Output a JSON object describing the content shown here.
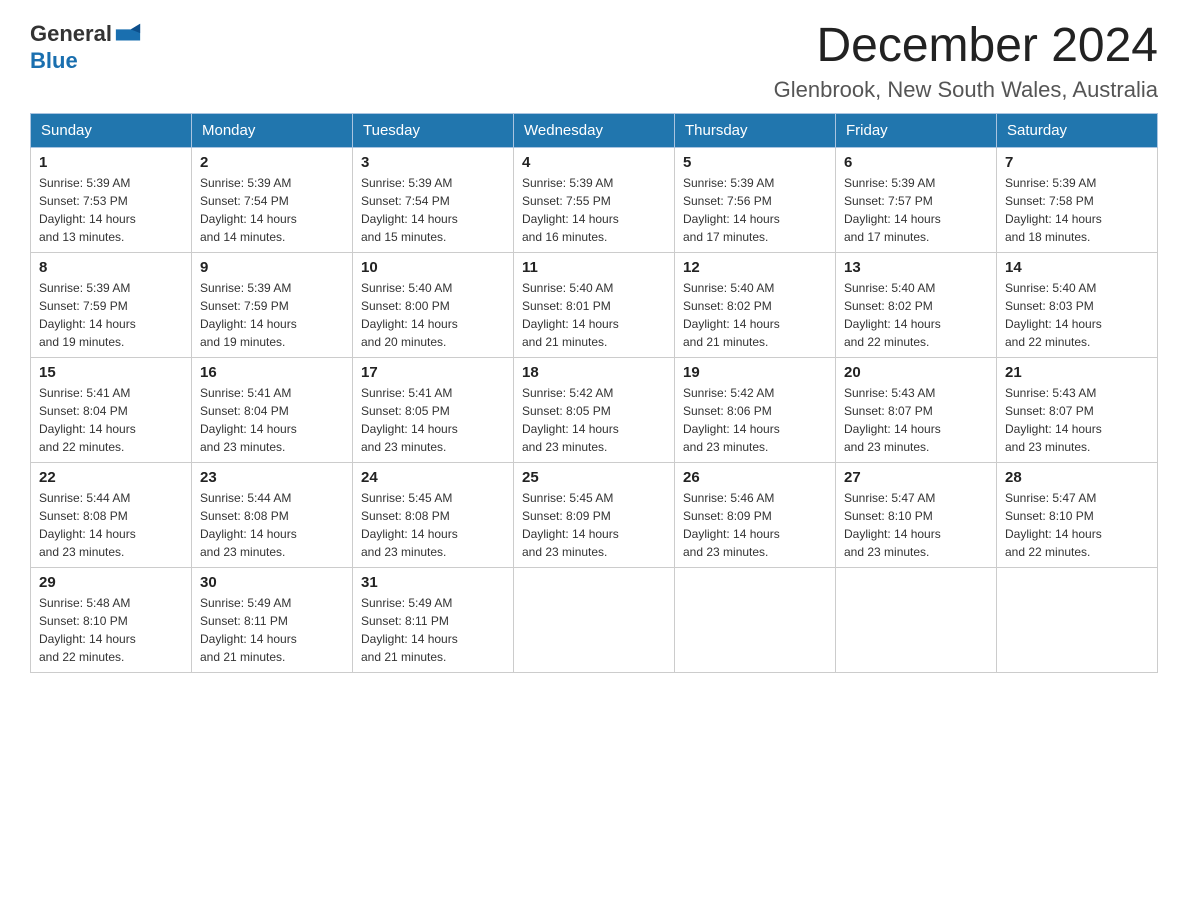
{
  "header": {
    "logo_general": "General",
    "logo_blue": "Blue",
    "month_title": "December 2024",
    "location": "Glenbrook, New South Wales, Australia"
  },
  "days_of_week": [
    "Sunday",
    "Monday",
    "Tuesday",
    "Wednesday",
    "Thursday",
    "Friday",
    "Saturday"
  ],
  "weeks": [
    [
      {
        "day": "1",
        "sunrise": "5:39 AM",
        "sunset": "7:53 PM",
        "daylight": "14 hours and 13 minutes."
      },
      {
        "day": "2",
        "sunrise": "5:39 AM",
        "sunset": "7:54 PM",
        "daylight": "14 hours and 14 minutes."
      },
      {
        "day": "3",
        "sunrise": "5:39 AM",
        "sunset": "7:54 PM",
        "daylight": "14 hours and 15 minutes."
      },
      {
        "day": "4",
        "sunrise": "5:39 AM",
        "sunset": "7:55 PM",
        "daylight": "14 hours and 16 minutes."
      },
      {
        "day": "5",
        "sunrise": "5:39 AM",
        "sunset": "7:56 PM",
        "daylight": "14 hours and 17 minutes."
      },
      {
        "day": "6",
        "sunrise": "5:39 AM",
        "sunset": "7:57 PM",
        "daylight": "14 hours and 17 minutes."
      },
      {
        "day": "7",
        "sunrise": "5:39 AM",
        "sunset": "7:58 PM",
        "daylight": "14 hours and 18 minutes."
      }
    ],
    [
      {
        "day": "8",
        "sunrise": "5:39 AM",
        "sunset": "7:59 PM",
        "daylight": "14 hours and 19 minutes."
      },
      {
        "day": "9",
        "sunrise": "5:39 AM",
        "sunset": "7:59 PM",
        "daylight": "14 hours and 19 minutes."
      },
      {
        "day": "10",
        "sunrise": "5:40 AM",
        "sunset": "8:00 PM",
        "daylight": "14 hours and 20 minutes."
      },
      {
        "day": "11",
        "sunrise": "5:40 AM",
        "sunset": "8:01 PM",
        "daylight": "14 hours and 21 minutes."
      },
      {
        "day": "12",
        "sunrise": "5:40 AM",
        "sunset": "8:02 PM",
        "daylight": "14 hours and 21 minutes."
      },
      {
        "day": "13",
        "sunrise": "5:40 AM",
        "sunset": "8:02 PM",
        "daylight": "14 hours and 22 minutes."
      },
      {
        "day": "14",
        "sunrise": "5:40 AM",
        "sunset": "8:03 PM",
        "daylight": "14 hours and 22 minutes."
      }
    ],
    [
      {
        "day": "15",
        "sunrise": "5:41 AM",
        "sunset": "8:04 PM",
        "daylight": "14 hours and 22 minutes."
      },
      {
        "day": "16",
        "sunrise": "5:41 AM",
        "sunset": "8:04 PM",
        "daylight": "14 hours and 23 minutes."
      },
      {
        "day": "17",
        "sunrise": "5:41 AM",
        "sunset": "8:05 PM",
        "daylight": "14 hours and 23 minutes."
      },
      {
        "day": "18",
        "sunrise": "5:42 AM",
        "sunset": "8:05 PM",
        "daylight": "14 hours and 23 minutes."
      },
      {
        "day": "19",
        "sunrise": "5:42 AM",
        "sunset": "8:06 PM",
        "daylight": "14 hours and 23 minutes."
      },
      {
        "day": "20",
        "sunrise": "5:43 AM",
        "sunset": "8:07 PM",
        "daylight": "14 hours and 23 minutes."
      },
      {
        "day": "21",
        "sunrise": "5:43 AM",
        "sunset": "8:07 PM",
        "daylight": "14 hours and 23 minutes."
      }
    ],
    [
      {
        "day": "22",
        "sunrise": "5:44 AM",
        "sunset": "8:08 PM",
        "daylight": "14 hours and 23 minutes."
      },
      {
        "day": "23",
        "sunrise": "5:44 AM",
        "sunset": "8:08 PM",
        "daylight": "14 hours and 23 minutes."
      },
      {
        "day": "24",
        "sunrise": "5:45 AM",
        "sunset": "8:08 PM",
        "daylight": "14 hours and 23 minutes."
      },
      {
        "day": "25",
        "sunrise": "5:45 AM",
        "sunset": "8:09 PM",
        "daylight": "14 hours and 23 minutes."
      },
      {
        "day": "26",
        "sunrise": "5:46 AM",
        "sunset": "8:09 PM",
        "daylight": "14 hours and 23 minutes."
      },
      {
        "day": "27",
        "sunrise": "5:47 AM",
        "sunset": "8:10 PM",
        "daylight": "14 hours and 23 minutes."
      },
      {
        "day": "28",
        "sunrise": "5:47 AM",
        "sunset": "8:10 PM",
        "daylight": "14 hours and 22 minutes."
      }
    ],
    [
      {
        "day": "29",
        "sunrise": "5:48 AM",
        "sunset": "8:10 PM",
        "daylight": "14 hours and 22 minutes."
      },
      {
        "day": "30",
        "sunrise": "5:49 AM",
        "sunset": "8:11 PM",
        "daylight": "14 hours and 21 minutes."
      },
      {
        "day": "31",
        "sunrise": "5:49 AM",
        "sunset": "8:11 PM",
        "daylight": "14 hours and 21 minutes."
      },
      null,
      null,
      null,
      null
    ]
  ],
  "labels": {
    "sunrise": "Sunrise:",
    "sunset": "Sunset:",
    "daylight": "Daylight:"
  }
}
